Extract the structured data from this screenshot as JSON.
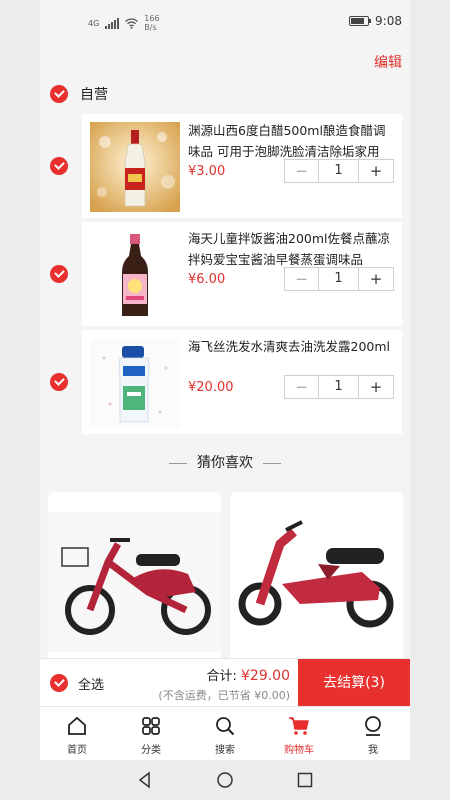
{
  "status": {
    "network": "4G",
    "speed_value": "166",
    "speed_unit": "B/s",
    "time": "9:08"
  },
  "header": {
    "edit_label": "编辑"
  },
  "store": {
    "name": "自营"
  },
  "cart_items": [
    {
      "title": "渊源山西6度白醋500ml酿造食醋调味品 可用于泡脚洗脸清洁除垢家用",
      "price": "¥3.00",
      "quantity": "1",
      "minus": "−",
      "plus": "+",
      "image": "vinegar-bottle"
    },
    {
      "title": "海天儿童拌饭酱油200ml佐餐点蘸凉拌妈爱宝宝酱油早餐蒸蛋调味品",
      "price": "¥6.00",
      "quantity": "1",
      "minus": "−",
      "plus": "+",
      "image": "soy-sauce-bottle"
    },
    {
      "title": "海飞丝洗发水清爽去油洗发露200ml",
      "price": "¥20.00",
      "quantity": "1",
      "minus": "−",
      "plus": "+",
      "image": "shampoo-bottle"
    }
  ],
  "recommend": {
    "heading": "猜你喜欢",
    "items": [
      {
        "image": "electric-scooter"
      },
      {
        "image": "electric-motorbike"
      }
    ]
  },
  "checkout": {
    "select_all": "全选",
    "total_label": "合计:",
    "total_value": "¥29.00",
    "fee_note": "(不含运费，已节省 ¥0.00)",
    "button": "去结算(3)"
  },
  "tabbar": [
    {
      "label": "首页",
      "icon": "home-icon",
      "active": false
    },
    {
      "label": "分类",
      "icon": "category-icon",
      "active": false
    },
    {
      "label": "搜索",
      "icon": "search-icon",
      "active": false
    },
    {
      "label": "购物车",
      "icon": "cart-icon",
      "active": true
    },
    {
      "label": "我",
      "icon": "user-icon",
      "active": false
    }
  ],
  "colors": {
    "accent": "#e8312f",
    "price": "#e0312e",
    "background": "#f4f4f4"
  }
}
